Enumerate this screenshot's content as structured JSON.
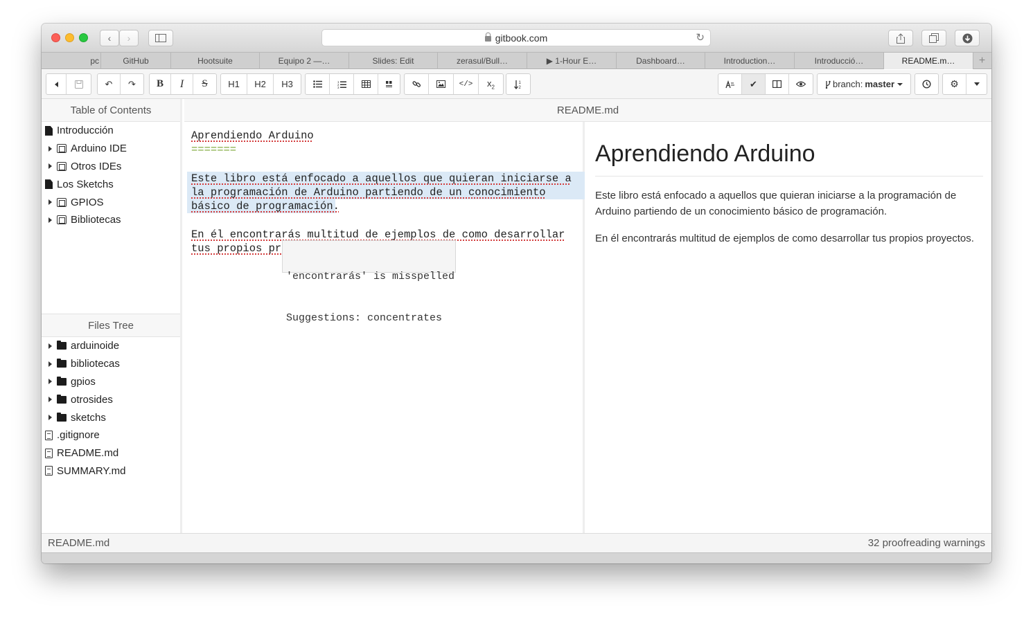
{
  "browser": {
    "url": "gitbook.com",
    "tabs": [
      "pc",
      "GitHub",
      "Hootsuite",
      "Equipo 2 —…",
      "Slides: Edit",
      "zerasul/Bull…",
      "▶ 1-Hour E…",
      "Dashboard…",
      "Introduction…",
      "Introducció…",
      "README.m…"
    ],
    "new_tab": "+"
  },
  "toolbar": {
    "h1": "H1",
    "h2": "H2",
    "h3": "H3",
    "branch_prefix": "branch:",
    "branch_name": "master"
  },
  "sidebar": {
    "toc_title": "Table of Contents",
    "toc": [
      {
        "label": "Introducción",
        "type": "file",
        "caret": false,
        "indent": 0
      },
      {
        "label": "Arduino IDE",
        "type": "docs",
        "caret": true,
        "indent": 1
      },
      {
        "label": "Otros IDEs",
        "type": "docs",
        "caret": true,
        "indent": 1
      },
      {
        "label": "Los Sketchs",
        "type": "file",
        "caret": false,
        "indent": 0
      },
      {
        "label": "GPIOS",
        "type": "docs",
        "caret": true,
        "indent": 1
      },
      {
        "label": "Bibliotecas",
        "type": "docs",
        "caret": true,
        "indent": 1
      }
    ],
    "files_title": "Files Tree",
    "files": [
      {
        "label": "arduinoide",
        "type": "folder",
        "caret": true
      },
      {
        "label": "bibliotecas",
        "type": "folder",
        "caret": true
      },
      {
        "label": "gpios",
        "type": "folder",
        "caret": true
      },
      {
        "label": "otrosides",
        "type": "folder",
        "caret": true
      },
      {
        "label": "sketchs",
        "type": "folder",
        "caret": true
      },
      {
        "label": ".gitignore",
        "type": "doc",
        "caret": false
      },
      {
        "label": "README.md",
        "type": "doc",
        "caret": false
      },
      {
        "label": "SUMMARY.md",
        "type": "doc",
        "caret": false
      }
    ]
  },
  "editor": {
    "filename": "README.md",
    "title_line": "Aprendiendo Arduino",
    "underline_line": "=======",
    "p1_l1": "Este libro está enfocado a aquellos que quieran iniciarse a",
    "p1_l2": "la programación de Arduino partiendo de un conocimiento",
    "p1_l3": "básico de programación.",
    "p2_l1": "En él encontrarás multitud de ejemplos de como desarrollar",
    "p2_l2": "tus propios pro",
    "tooltip_l1": "'encontrarás' is misspelled",
    "tooltip_l2": "Suggestions: concentrates"
  },
  "preview": {
    "heading": "Aprendiendo Arduino",
    "p1": "Este libro está enfocado a aquellos que quieran iniciarse a la programación de Arduino partiendo de un conocimiento básico de programación.",
    "p2": "En él encontrarás multitud de ejemplos de como desarrollar tus propios proyectos."
  },
  "status": {
    "file": "README.md",
    "warnings": "32 proofreading warnings"
  }
}
